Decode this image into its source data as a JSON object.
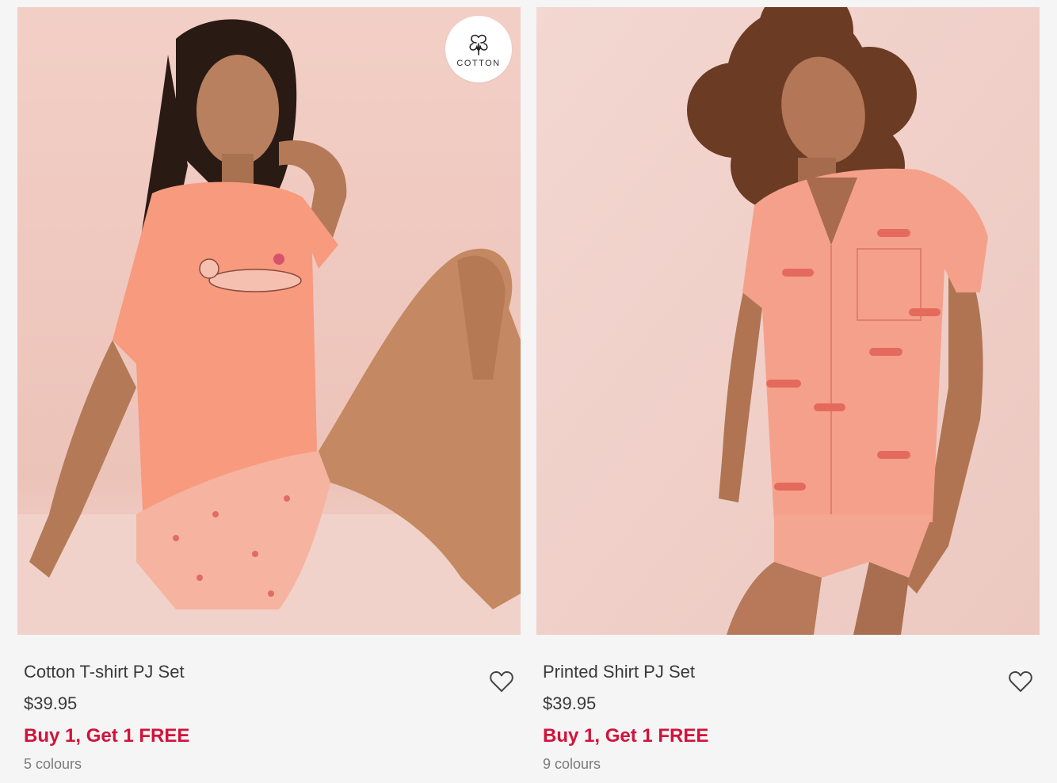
{
  "theme": {
    "promo_color": "#d1133a",
    "text_color": "#3a3a3a",
    "muted_color": "#7a7a7a",
    "background": "#f5f5f5"
  },
  "products": [
    {
      "name": "Cotton T-shirt PJ Set",
      "price": "$39.95",
      "promo": "Buy 1, Get 1 FREE",
      "colours": "5 colours",
      "badge": "COTTON",
      "badge_icon": "cotton-flower-icon",
      "favorite_icon": "heart-outline-icon",
      "photo_tone": "#f0c7bd",
      "garment_color": "#f79a7e"
    },
    {
      "name": "Printed Shirt PJ Set",
      "price": "$39.95",
      "promo": "Buy 1, Get 1 FREE",
      "colours": "9 colours",
      "favorite_icon": "heart-outline-icon",
      "photo_tone": "#f0d0ca",
      "garment_color": "#f5a08a"
    }
  ]
}
